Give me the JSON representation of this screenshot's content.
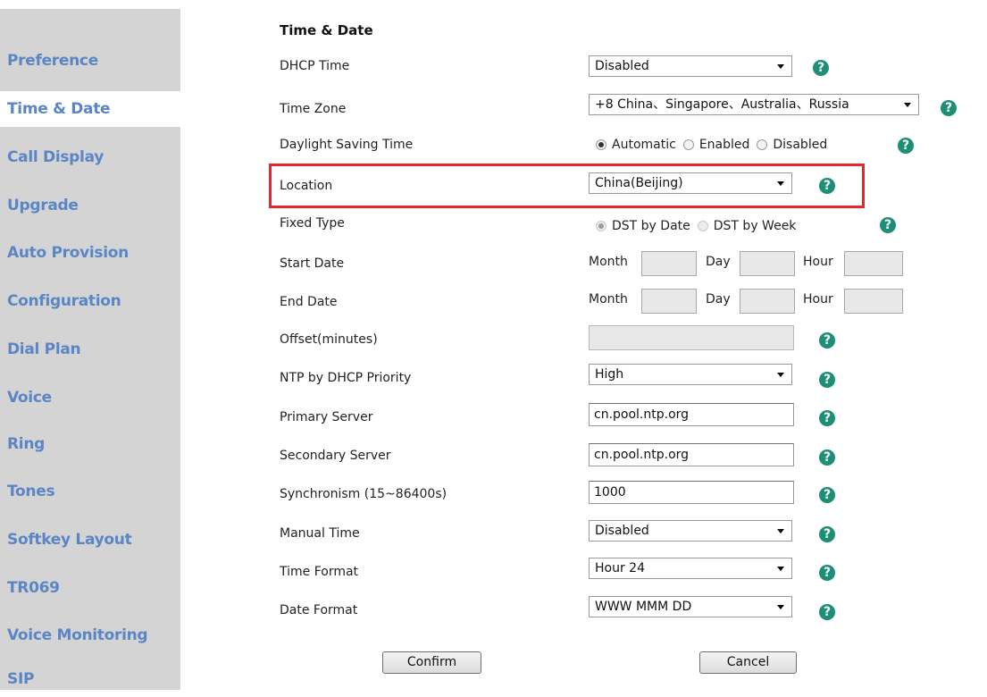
{
  "sidebar": {
    "items": [
      {
        "label": "Preference"
      },
      {
        "label": "Time & Date"
      },
      {
        "label": "Call Display"
      },
      {
        "label": "Upgrade"
      },
      {
        "label": "Auto Provision"
      },
      {
        "label": "Configuration"
      },
      {
        "label": "Dial Plan"
      },
      {
        "label": "Voice"
      },
      {
        "label": "Ring"
      },
      {
        "label": "Tones"
      },
      {
        "label": "Softkey Layout"
      },
      {
        "label": "TR069"
      },
      {
        "label": "Voice Monitoring"
      },
      {
        "label": "SIP"
      }
    ]
  },
  "main": {
    "title": "Time & Date",
    "help_glyph": "?",
    "dhcp_time": {
      "label": "DHCP Time",
      "value": "Disabled"
    },
    "time_zone": {
      "label": "Time Zone",
      "value": "+8 China、Singapore、Australia、Russia"
    },
    "daylight": {
      "label": "Daylight Saving Time",
      "options": [
        "Automatic",
        "Enabled",
        "Disabled"
      ],
      "selected": "Automatic"
    },
    "location": {
      "label": "Location",
      "value": "China(Beijing)"
    },
    "fixed_type": {
      "label": "Fixed Type",
      "options": [
        "DST by Date",
        "DST by Week"
      ],
      "selected": "DST by Date"
    },
    "start_date": {
      "label": "Start Date",
      "month": "Month",
      "day": "Day",
      "hour": "Hour"
    },
    "end_date": {
      "label": "End Date",
      "month": "Month",
      "day": "Day",
      "hour": "Hour"
    },
    "offset": {
      "label": "Offset(minutes)",
      "value": ""
    },
    "ntp_priority": {
      "label": "NTP by DHCP Priority",
      "value": "High"
    },
    "primary_server": {
      "label": "Primary Server",
      "value": "cn.pool.ntp.org"
    },
    "secondary_server": {
      "label": "Secondary Server",
      "value": "cn.pool.ntp.org"
    },
    "synchronism": {
      "label": "Synchronism (15~86400s)",
      "value": "1000"
    },
    "manual_time": {
      "label": "Manual Time",
      "value": "Disabled"
    },
    "time_format": {
      "label": "Time Format",
      "value": "Hour 24"
    },
    "date_format": {
      "label": "Date Format",
      "value": "WWW MMM DD"
    }
  },
  "buttons": {
    "confirm": "Confirm",
    "cancel": "Cancel"
  },
  "colors": {
    "highlight": "#e8262f",
    "help": "#1e8f77",
    "nav_text": "#5b86c6"
  }
}
